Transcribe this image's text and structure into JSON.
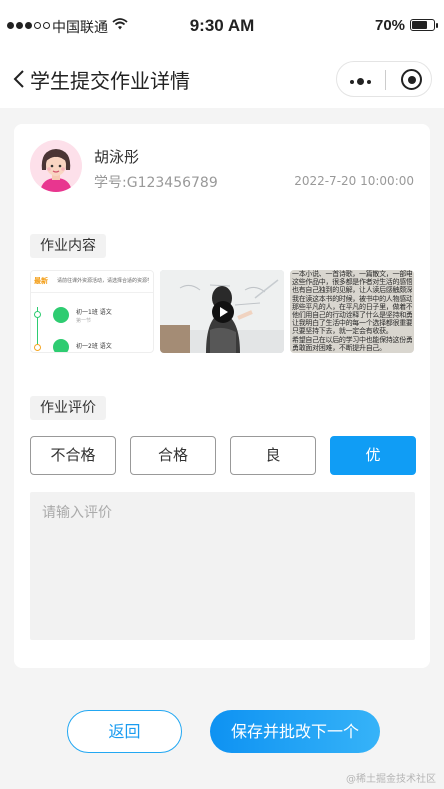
{
  "status_bar": {
    "carrier": "中国联通",
    "time": "9:30 AM",
    "battery": "70%"
  },
  "nav": {
    "title": "学生提交作业详情"
  },
  "student": {
    "name": "胡泳彤",
    "id": "学号:G123456789",
    "submitted_at": "2022-7-20 10:00:00"
  },
  "homework": {
    "section_label": "作业内容",
    "thumb1": {
      "header": "最新",
      "notice": "请前往课外资源活动，请选择合适的资源学习...",
      "items": [
        {
          "title": "初一1班  语文",
          "sub": "第一节"
        },
        {
          "title": "初一2班  语文",
          "sub": ""
        }
      ]
    },
    "thumb2": {
      "icon": "play-icon"
    },
    "thumb3": {
      "lines": [
        "一本小说、一首诗歌，一篇散文，一部电影。",
        "这些作品中，很多都是作者对生活的感悟，",
        "也有自己独到的见解，让人读后感触颇深。",
        "我在读这本书的时候，被书中的人物感动了。",
        "那些平凡的人，在平凡的日子里，做着不平凡的事。",
        "他们用自己的行动诠释了什么是坚持和勇敢，",
        "让我明白了生活中的每一个选择都很重要，",
        "只要坚持下去，就一定会有收获。",
        "希望自己在以后的学习中也能保持这份勇气，",
        "勇敢面对困难，不断提升自己。"
      ]
    }
  },
  "review": {
    "section_label": "作业评价",
    "grades": [
      "不合格",
      "合格",
      "良",
      "优"
    ],
    "selected": "优",
    "comment_placeholder": "请输入评价",
    "comment_value": ""
  },
  "actions": {
    "back_label": "返回",
    "save_label": "保存并批改下一个"
  },
  "watermark": "@稀土掘金技术社区",
  "colors": {
    "primary": "#109df5",
    "button_gradient_start": "#0e92f2",
    "button_gradient_end": "#36b3f8",
    "page_bg": "#f4f4f4"
  }
}
